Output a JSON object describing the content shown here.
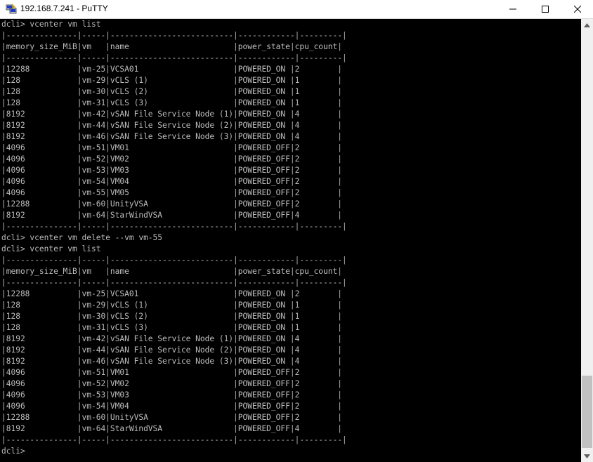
{
  "window": {
    "title": "192.168.7.241 - PuTTY"
  },
  "terminal": {
    "lines": [
      "dcli> vcenter vm list",
      "|---------------|-----|--------------------------|------------|---------|",
      "|memory_size_MiB|vm   |name                      |power_state|cpu_count|",
      "|---------------|-----|--------------------------|------------|---------|",
      "|12288          |vm-25|VCSA01                    |POWERED_ON |2        |",
      "|128            |vm-29|vCLS (1)                  |POWERED_ON |1        |",
      "|128            |vm-30|vCLS (2)                  |POWERED_ON |1        |",
      "|128            |vm-31|vCLS (3)                  |POWERED_ON |1        |",
      "|8192           |vm-42|vSAN File Service Node (1)|POWERED_ON |4        |",
      "|8192           |vm-44|vSAN File Service Node (2)|POWERED_ON |4        |",
      "|8192           |vm-46|vSAN File Service Node (3)|POWERED_ON |4        |",
      "|4096           |vm-51|VM01                      |POWERED_OFF|2        |",
      "|4096           |vm-52|VM02                      |POWERED_OFF|2        |",
      "|4096           |vm-53|VM03                      |POWERED_OFF|2        |",
      "|4096           |vm-54|VM04                      |POWERED_OFF|2        |",
      "|4096           |vm-55|VM05                      |POWERED_OFF|2        |",
      "|12288          |vm-60|UnityVSA                  |POWERED_OFF|2        |",
      "|8192           |vm-64|StarWindVSA               |POWERED_OFF|4        |",
      "|---------------|-----|--------------------------|------------|---------|",
      "dcli> vcenter vm delete --vm vm-55",
      "dcli> vcenter vm list",
      "|---------------|-----|--------------------------|------------|---------|",
      "|memory_size_MiB|vm   |name                      |power_state|cpu_count|",
      "|---------------|-----|--------------------------|------------|---------|",
      "|12288          |vm-25|VCSA01                    |POWERED_ON |2        |",
      "|128            |vm-29|vCLS (1)                  |POWERED_ON |1        |",
      "|128            |vm-30|vCLS (2)                  |POWERED_ON |1        |",
      "|128            |vm-31|vCLS (3)                  |POWERED_ON |1        |",
      "|8192           |vm-42|vSAN File Service Node (1)|POWERED_ON |4        |",
      "|8192           |vm-44|vSAN File Service Node (2)|POWERED_ON |4        |",
      "|8192           |vm-46|vSAN File Service Node (3)|POWERED_ON |4        |",
      "|4096           |vm-51|VM01                      |POWERED_OFF|2        |",
      "|4096           |vm-52|VM02                      |POWERED_OFF|2        |",
      "|4096           |vm-53|VM03                      |POWERED_OFF|2        |",
      "|4096           |vm-54|VM04                      |POWERED_OFF|2        |",
      "|12288          |vm-60|UnityVSA                  |POWERED_OFF|2        |",
      "|8192           |vm-64|StarWindVSA               |POWERED_OFF|4        |",
      "|---------------|-----|--------------------------|------------|---------|",
      "dcli> "
    ]
  },
  "icons": {
    "app": "putty-icon",
    "minimize": "minimize-icon",
    "maximize": "maximize-icon",
    "close": "close-icon",
    "scroll_up": "scroll-up-arrow-icon",
    "scroll_down": "scroll-down-arrow-icon"
  },
  "colors": {
    "terminal_bg": "#000000",
    "terminal_fg": "#bbbbbb",
    "titlebar_bg": "#ffffff",
    "scrollbar_track": "#f0f0f0",
    "scrollbar_thumb": "#c1c1c1"
  }
}
